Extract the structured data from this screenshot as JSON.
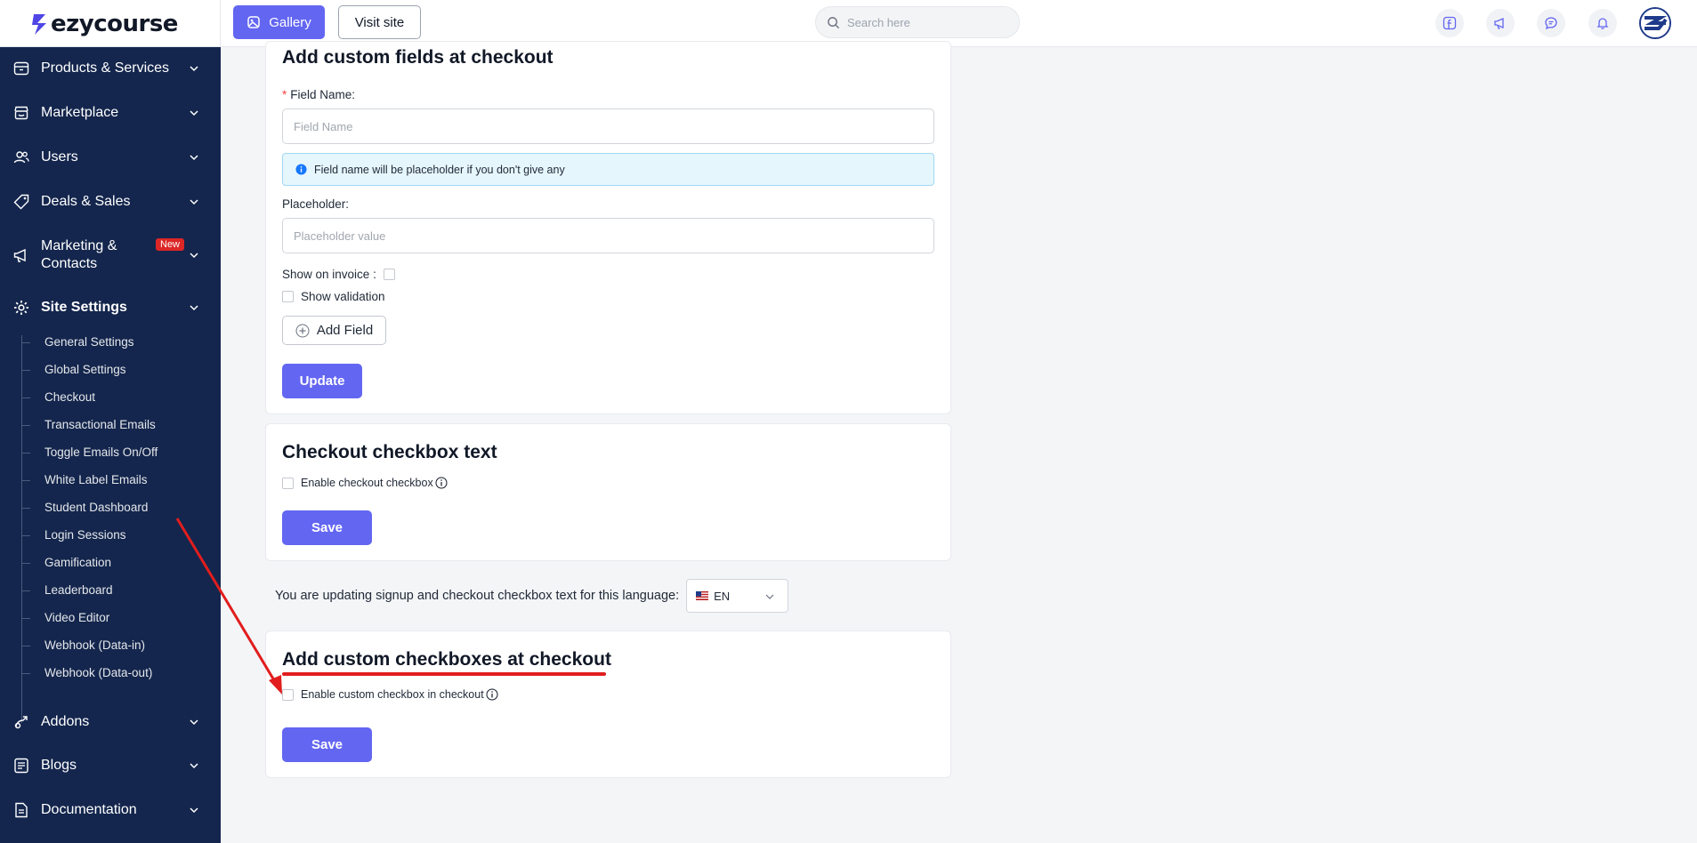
{
  "app": {
    "brand": "ezycourse"
  },
  "topbar": {
    "gallery_label": "Gallery",
    "visit_label": "Visit site",
    "search_placeholder": "Search here",
    "icons": [
      "facebook-icon",
      "megaphone-icon",
      "chat-icon",
      "bell-icon"
    ]
  },
  "sidebar": {
    "items": [
      {
        "label": "Products & Services",
        "icon": "box-icon"
      },
      {
        "label": "Marketplace",
        "icon": "store-icon"
      },
      {
        "label": "Users",
        "icon": "users-icon"
      },
      {
        "label": "Deals & Sales",
        "icon": "tag-icon"
      },
      {
        "label": "Marketing & Contacts",
        "icon": "megaphone-icon",
        "badge": "New"
      },
      {
        "label": "Site Settings",
        "icon": "gear-icon",
        "active": true
      },
      {
        "label": "Addons",
        "icon": "addon-icon"
      },
      {
        "label": "Blogs",
        "icon": "blog-icon"
      },
      {
        "label": "Documentation",
        "icon": "doc-icon"
      }
    ],
    "sub_items": [
      "General Settings",
      "Global Settings",
      "Checkout",
      "Transactional Emails",
      "Toggle Emails On/Off",
      "White Label Emails",
      "Student Dashboard",
      "Login Sessions",
      "Gamification",
      "Leaderboard",
      "Video Editor",
      "Webhook (Data-in)",
      "Webhook (Data-out)"
    ]
  },
  "custom_fields": {
    "title": "Add custom fields at checkout",
    "field_name_label": "Field Name",
    "field_name_placeholder": "Field Name",
    "info_text": "Field name will be placeholder if you don't give any",
    "placeholder_label": "Placeholder",
    "placeholder_placeholder": "Placeholder value",
    "show_on_invoice_label": "Show on invoice",
    "show_validation_label": "Show validation",
    "add_field_label": "Add Field",
    "update_label": "Update"
  },
  "checkbox_text": {
    "title": "Checkout checkbox text",
    "enable_label": "Enable checkout checkbox",
    "save_label": "Save"
  },
  "language": {
    "prompt": "You are updating signup and checkout checkbox text for this language:",
    "selected": "EN"
  },
  "custom_checkboxes": {
    "title": "Add custom checkboxes at checkout",
    "enable_label": "Enable custom checkbox in checkout",
    "save_label": "Save"
  },
  "colors": {
    "accent": "#6366f1",
    "sidebar_bg": "#14264d",
    "annotation": "#e11d1d"
  }
}
